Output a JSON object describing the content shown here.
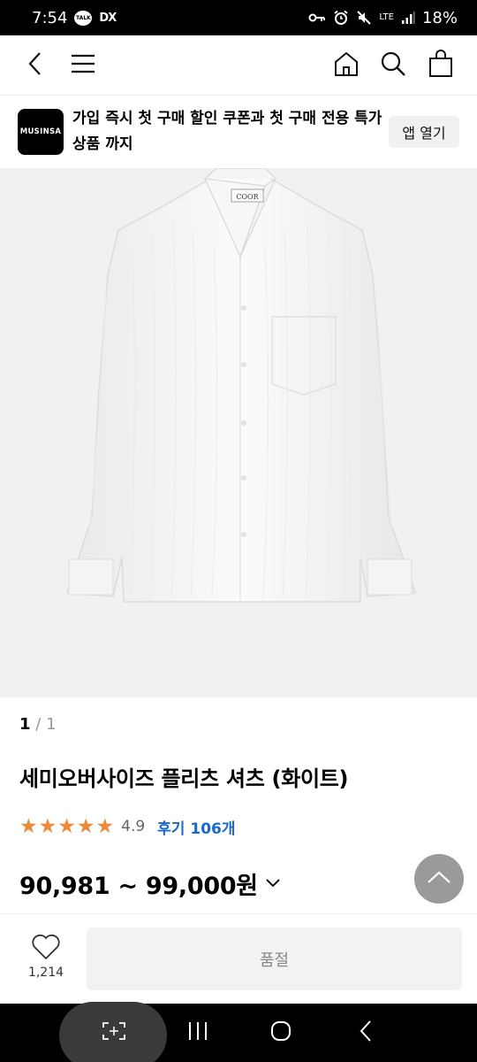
{
  "status_bar": {
    "time": "7:54",
    "talk_badge": "TALK",
    "dx_badge": "DX",
    "network": "LTE",
    "battery": "18%"
  },
  "header": {
    "icons": [
      "back-icon",
      "menu-icon",
      "home-icon",
      "search-icon",
      "cart-icon"
    ]
  },
  "promo": {
    "logo_text": "MUSINSA",
    "text": "가입 즉시 첫 구매 할인 쿠폰과 첫 구매 전용 특가 상품 까지",
    "open_app_label": "앱 열기"
  },
  "product_image": {
    "brand_tag": "COOR"
  },
  "pagination": {
    "current": "1",
    "separator": "/",
    "total": "1"
  },
  "product": {
    "title": "세미오버사이즈 플리츠 셔츠 (화이트)",
    "stars": 5,
    "rating": "4.9",
    "review_label": "후기 106개",
    "price_range": "90,981 ~ 99,000원"
  },
  "bottom_bar": {
    "like_count": "1,214",
    "soldout_label": "품절"
  },
  "colors": {
    "star": "#ee8b3a",
    "review_link": "#1a68c9",
    "image_bg": "#f1f1f1",
    "soldout_bg": "#f2f2f2"
  }
}
